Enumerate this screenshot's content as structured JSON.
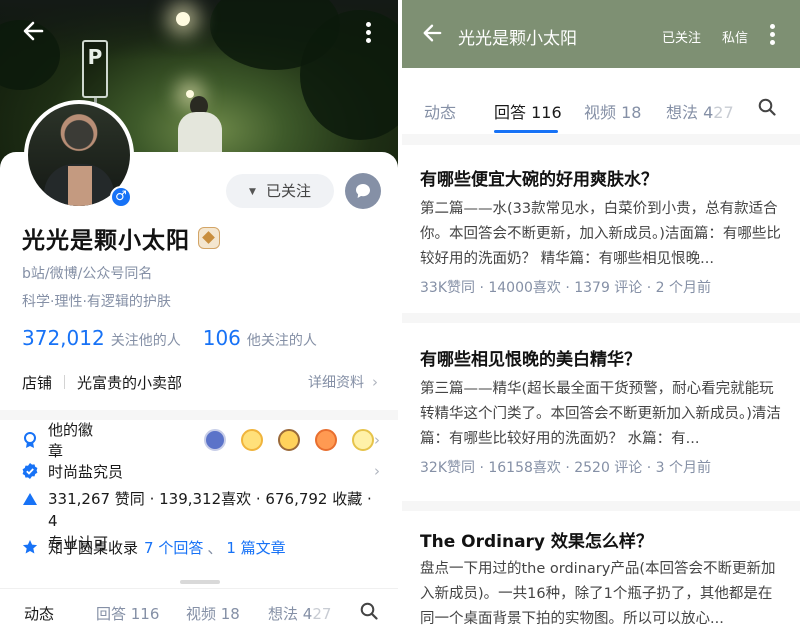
{
  "profile": {
    "name": "光光是颗小太阳",
    "tagline1": "b站/微博/公众号同名",
    "tagline2": "科学·理性·有逻辑的护肤",
    "follow_btn": "已关注",
    "followers_num": "372,012",
    "followers_lbl": "关注他的人",
    "following_num": "106",
    "following_lbl": "他关注的人",
    "shop_label": "店铺",
    "shop_name": "光富贵的小卖部",
    "detail_link": "详细资料",
    "badges_label": "他的徽章",
    "salt_label": "时尚盐究员",
    "likes_line": "331,267 赞同 · 139,312喜欢 · 676,792 收藏 · 4",
    "likes_line2": "专业认可",
    "roundtable_prefix": "知乎圆桌收录",
    "roundtable_answers": "7 个回答",
    "roundtable_sep": "、",
    "roundtable_articles": "1 篇文章"
  },
  "left_tabs": {
    "dynamics": "动态",
    "answers": "回答 116",
    "videos": "视频 18",
    "thoughts": "想法 4",
    "thoughts_fade": "27"
  },
  "topbar": {
    "title": "光光是颗小太阳",
    "followed": "已关注",
    "message": "私信"
  },
  "right_tabs": {
    "dynamics": "动态",
    "answers": "回答 116",
    "videos": "视频 18",
    "thoughts": "想法 4",
    "thoughts_fade": "27"
  },
  "answers": [
    {
      "question": "有哪些便宜大碗的好用爽肤水？",
      "excerpt": "第二篇——水(33款常见水，白菜价到小贵，总有款适合你。本回答会不断更新，加入新成员。)洁面篇：有哪些比较好用的洗面奶？ 精华篇：有哪些相见恨晚...",
      "meta": "33K赞同 · 14000喜欢 · 1379 评论 · 2 个月前"
    },
    {
      "question": "有哪些相见恨晚的美白精华？",
      "excerpt": "第三篇——精华(超长最全面干货预警，耐心看完就能玩转精华这个门类了。本回答会不断更新加入新成员。)清洁篇：有哪些比较好用的洗面奶？ 水篇：有...",
      "meta": "32K赞同 · 16158喜欢 · 2520 评论 · 3 个月前"
    },
    {
      "question": "The Ordinary 效果怎么样？",
      "excerpt": "盘点一下用过的the ordinary产品(本回答会不断更新加入新成员)。一共16种，除了1个瓶子扔了，其他都是在同一个桌面背景下拍的实物图。所以可以放心...",
      "meta": ""
    }
  ],
  "colors": {
    "accent": "#1772f6",
    "topbar": "#7e9073",
    "muted": "#8590a6"
  }
}
